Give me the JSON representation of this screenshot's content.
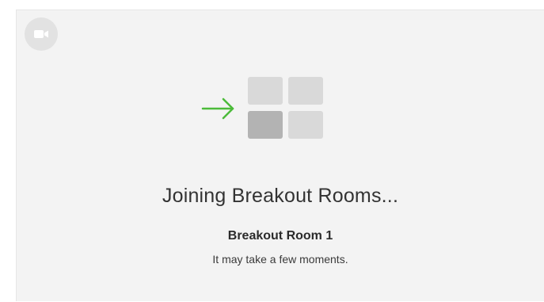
{
  "dialog": {
    "camera_icon": "video-camera-icon",
    "arrow_icon": "right-arrow-icon",
    "arrow_color": "#4cbb3a",
    "tiles_icon": "breakout-rooms-grid-icon",
    "title": "Joining Breakout Rooms...",
    "room_name": "Breakout Room 1",
    "subtitle": "It may take a few moments."
  }
}
